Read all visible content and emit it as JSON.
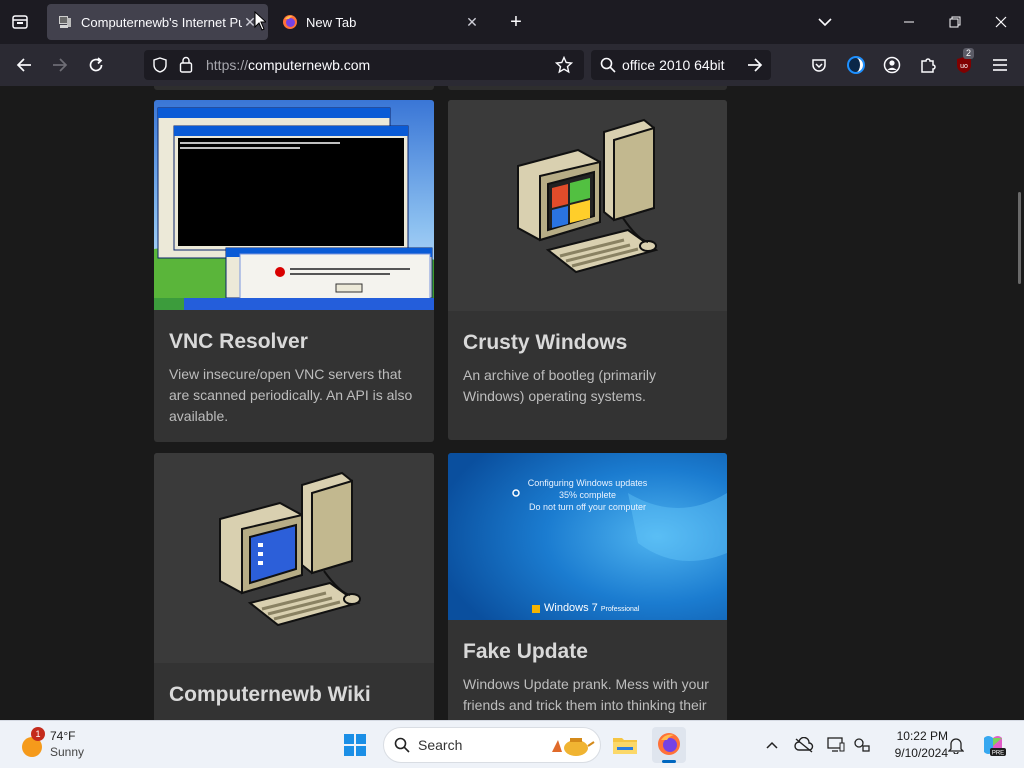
{
  "browser": {
    "tabs": [
      {
        "title": "Computernewb's Internet Pub",
        "active": true
      },
      {
        "title": "New Tab",
        "active": false
      }
    ],
    "url_protocol": "https://",
    "url_host": "computernewb.com",
    "search_query": "office 2010 64bit",
    "extension_badge": "2"
  },
  "cards": [
    {
      "title": "VNC Resolver",
      "description": "View insecure/open VNC servers that are scanned periodically. An API is also available."
    },
    {
      "title": "Crusty Windows",
      "description": "An archive of bootleg (primarily Windows) operating systems."
    },
    {
      "title": "Computernewb Wiki",
      "description": ""
    },
    {
      "title": "Fake Update",
      "description": "Windows Update prank. Mess with your friends and trick them into thinking their"
    }
  ],
  "fake_update_screen": {
    "line1": "Configuring Windows updates",
    "line2": "35% complete",
    "line3": "Do not turn off your computer",
    "brand": "Windows 7",
    "edition": "Professional"
  },
  "taskbar": {
    "weather_temp": "74°F",
    "weather_cond": "Sunny",
    "weather_badge": "1",
    "search_label": "Search",
    "time": "10:22 PM",
    "date": "9/10/2024"
  },
  "colors": {
    "taskbar_bg": "#eef2f8",
    "tab_active": "#42414d",
    "toolbar": "#2b2a33",
    "card_bg": "#333333"
  }
}
